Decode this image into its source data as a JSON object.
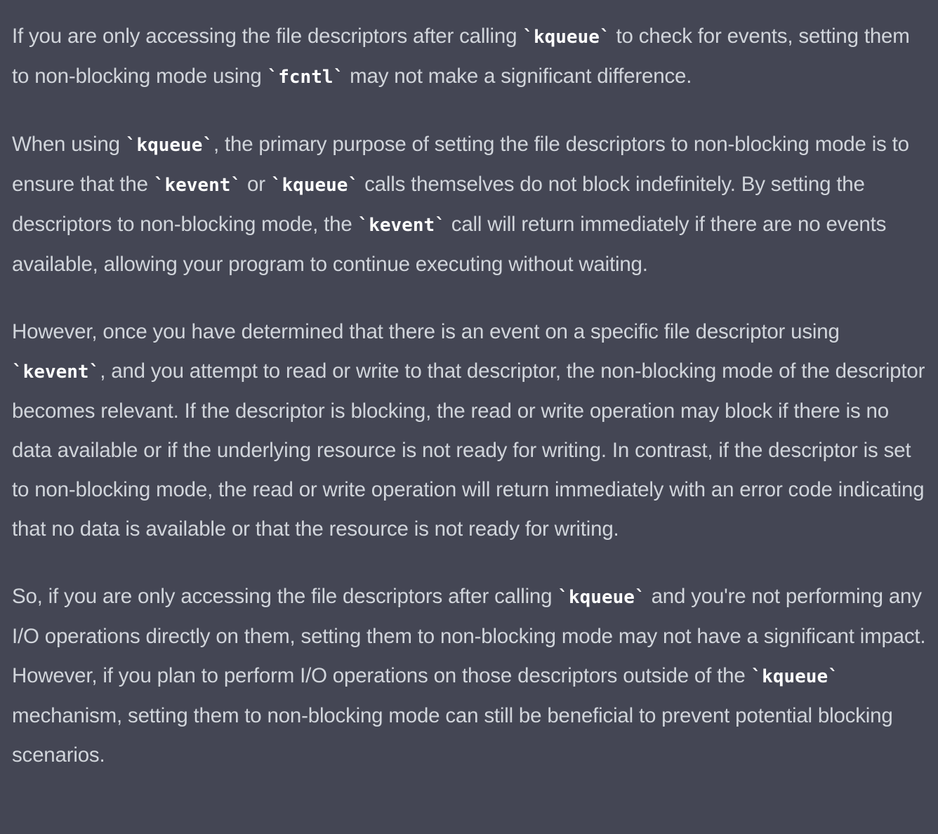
{
  "paragraphs": [
    {
      "segments": [
        {
          "t": "text",
          "v": "If you are only accessing the file descriptors after calling "
        },
        {
          "t": "code",
          "v": "`kqueue`"
        },
        {
          "t": "text",
          "v": " to check for events, setting them to non-blocking mode using "
        },
        {
          "t": "code",
          "v": "`fcntl`"
        },
        {
          "t": "text",
          "v": " may not make a significant difference."
        }
      ]
    },
    {
      "segments": [
        {
          "t": "text",
          "v": "When using "
        },
        {
          "t": "code",
          "v": "`kqueue`"
        },
        {
          "t": "text",
          "v": ", the primary purpose of setting the file descriptors to non-blocking mode is to ensure that the "
        },
        {
          "t": "code",
          "v": "`kevent`"
        },
        {
          "t": "text",
          "v": " or "
        },
        {
          "t": "code",
          "v": "`kqueue`"
        },
        {
          "t": "text",
          "v": " calls themselves do not block indefinitely. By setting the descriptors to non-blocking mode, the "
        },
        {
          "t": "code",
          "v": "`kevent`"
        },
        {
          "t": "text",
          "v": " call will return immediately if there are no events available, allowing your program to continue executing without waiting."
        }
      ]
    },
    {
      "segments": [
        {
          "t": "text",
          "v": "However, once you have determined that there is an event on a specific file descriptor using "
        },
        {
          "t": "code",
          "v": "`kevent`"
        },
        {
          "t": "text",
          "v": ", and you attempt to read or write to that descriptor, the non-blocking mode of the descriptor becomes relevant. If the descriptor is blocking, the read or write operation may block if there is no data available or if the underlying resource is not ready for writing. In contrast, if the descriptor is set to non-blocking mode, the read or write operation will return immediately with an error code indicating that no data is available or that the resource is not ready for writing."
        }
      ]
    },
    {
      "segments": [
        {
          "t": "text",
          "v": "So, if you are only accessing the file descriptors after calling "
        },
        {
          "t": "code",
          "v": "`kqueue`"
        },
        {
          "t": "text",
          "v": " and you're not performing any I/O operations directly on them, setting them to non-blocking mode may not have a significant impact. However, if you plan to perform I/O operations on those descriptors outside of the "
        },
        {
          "t": "code",
          "v": "`kqueue`"
        },
        {
          "t": "text",
          "v": " mechanism, setting them to non-blocking mode can still be beneficial to prevent potential blocking scenarios."
        }
      ]
    }
  ]
}
